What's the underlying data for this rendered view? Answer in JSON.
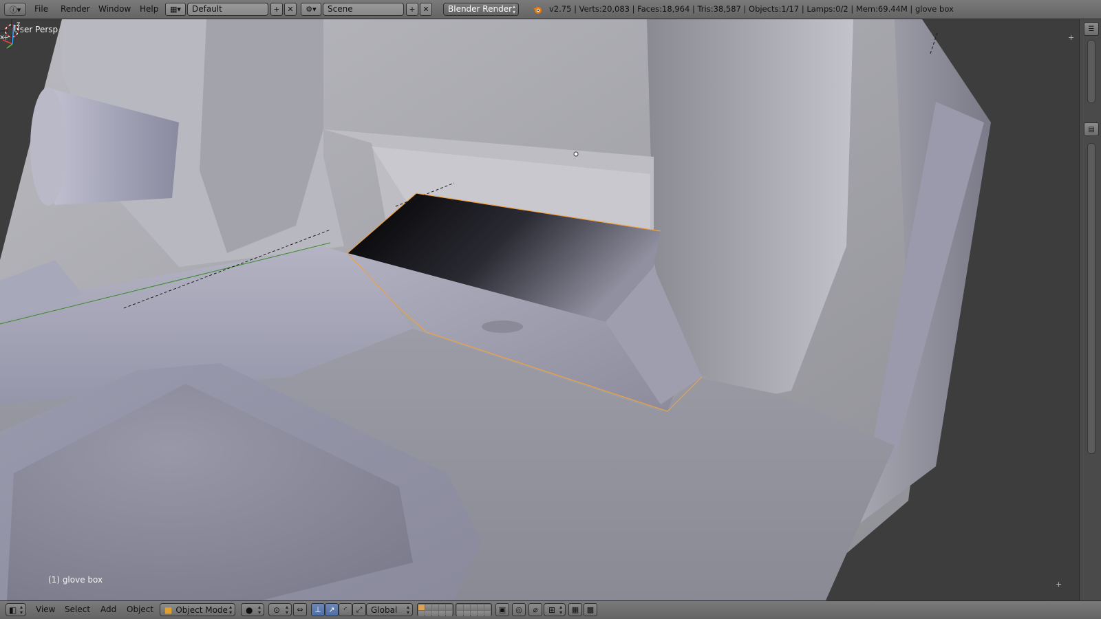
{
  "header": {
    "editor_type_icon": "info-icon",
    "menus": [
      "File",
      "Render",
      "Window",
      "Help"
    ],
    "screen_layout": "Default",
    "scene": "Scene",
    "render_engine": "Blender Render",
    "status": "v2.75 | Verts:20,083 | Faces:18,964 | Tris:38,587 | Objects:1/17 | Lamps:0/2 | Mem:69.44M | glove box"
  },
  "viewport": {
    "view_name": "User Persp",
    "active_object": "(1) glove box",
    "axis_labels": {
      "x": "x",
      "z": "z"
    },
    "colors": {
      "background": "#3d3d3d",
      "selection_outline": "#f0a040",
      "x_axis": "#3a8a2a"
    }
  },
  "footer": {
    "editor_type_icon": "3d-view-icon",
    "menus": [
      "View",
      "Select",
      "Add",
      "Object"
    ],
    "mode": "Object Mode",
    "transform_orientation": "Global",
    "shading_icon": "solid-shading-icon",
    "pivot_icon": "pivot-point-icon"
  }
}
